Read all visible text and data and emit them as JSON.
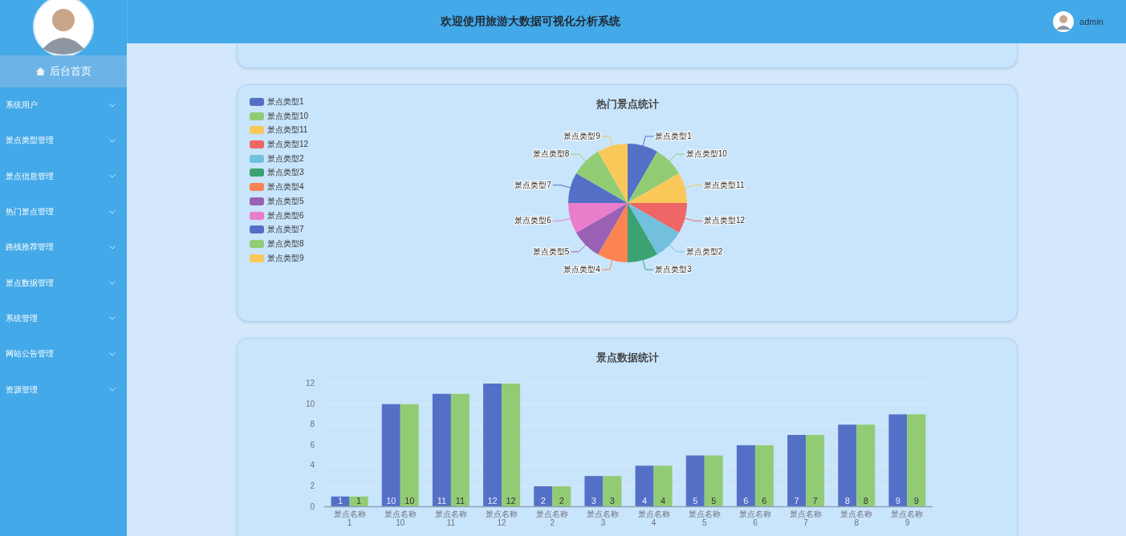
{
  "header": {
    "title": "欢迎使用旅游大数据可视化分析系统",
    "user": "admin"
  },
  "sidebar": {
    "home": {
      "label": "后台首页",
      "selected": true
    },
    "items": [
      {
        "label": "系统用户",
        "expanded": false
      },
      {
        "label": "景点类型管理",
        "expanded": false
      },
      {
        "label": "景点信息管理",
        "expanded": false
      },
      {
        "label": "热门景点管理",
        "expanded": false
      },
      {
        "label": "路线推荐管理",
        "expanded": false
      },
      {
        "label": "景点数据管理",
        "expanded": false
      },
      {
        "label": "系统管理",
        "expanded": false
      },
      {
        "label": "网站公告管理",
        "expanded": false
      },
      {
        "label": "资源管理",
        "expanded": false
      }
    ]
  },
  "pie_card": {
    "legend": [
      {
        "label": "景点类型1",
        "color": "#5470c6"
      },
      {
        "label": "景点类型10",
        "color": "#91cc75"
      },
      {
        "label": "景点类型11",
        "color": "#fac858"
      },
      {
        "label": "景点类型12",
        "color": "#ee6666"
      },
      {
        "label": "景点类型2",
        "color": "#73c0de"
      },
      {
        "label": "景点类型3",
        "color": "#3ba272"
      },
      {
        "label": "景点类型4",
        "color": "#fc8452"
      },
      {
        "label": "景点类型5",
        "color": "#9a60b4"
      },
      {
        "label": "景点类型6",
        "color": "#ea7ccc"
      },
      {
        "label": "景点类型7",
        "color": "#5470c6"
      },
      {
        "label": "景点类型8",
        "color": "#91cc75"
      },
      {
        "label": "景点类型9",
        "color": "#fac858"
      }
    ],
    "chart_data": {
      "type": "pie",
      "title": "热门景点统计",
      "categories": [
        "景点类型1",
        "景点类型10",
        "景点类型11",
        "景点类型12",
        "景点类型2",
        "景点类型3",
        "景点类型4",
        "景点类型5",
        "景点类型6",
        "景点类型7",
        "景点类型8",
        "景点类型9"
      ],
      "values": [
        1,
        1,
        1,
        1,
        1,
        1,
        1,
        1,
        1,
        1,
        1,
        1
      ]
    }
  },
  "bar_card": {
    "chart_data": {
      "type": "bar",
      "title": "景点数据统计",
      "categories": [
        "景点名称\n1",
        "景点名称\n10",
        "景点名称\n11",
        "景点名称\n12",
        "景点名称\n2",
        "景点名称\n3",
        "景点名称\n4",
        "景点名称\n5",
        "景点名称\n6",
        "景点名称\n7",
        "景点名称\n8",
        "景点名称\n9"
      ],
      "series": [
        {
          "color": "#5470c6",
          "values": [
            1,
            10,
            11,
            12,
            2,
            3,
            4,
            5,
            6,
            7,
            8,
            9
          ]
        },
        {
          "color": "#91cc75",
          "values": [
            1,
            10,
            11,
            12,
            2,
            3,
            4,
            5,
            6,
            7,
            8,
            9
          ]
        }
      ],
      "ylim": [
        0,
        12
      ],
      "yticks": [
        0,
        2,
        4,
        6,
        8,
        10,
        12
      ],
      "grid": true,
      "data_labels": true
    }
  }
}
